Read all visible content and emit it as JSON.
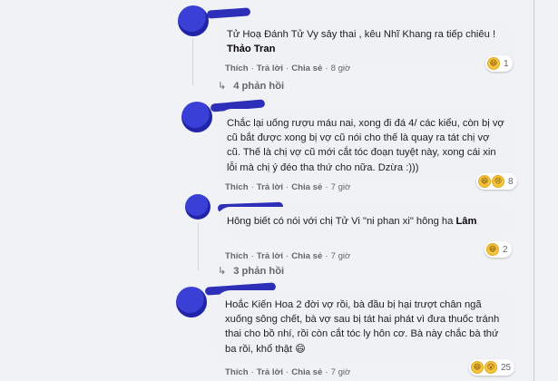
{
  "actions": {
    "like": "Thích",
    "reply": "Trả lời",
    "share": "Chia sẻ"
  },
  "comments": [
    {
      "text": "Tử Hoạ Đánh Tử Vy sảy thai , kêu Nhĩ Khang ra tiếp chiêu !",
      "tag": "Thảo Tran",
      "time": "8 giờ",
      "reaction_count": "1",
      "reactions": [
        "haha-icon"
      ]
    },
    {
      "text": "Chắc lại uống rượu máu nai, xong đi đá 4/ các kiểu, còn bị vợ cũ bắt được xong bị vợ cũ nói cho thế là quay ra tát chị vợ cũ. Thế là chị vợ cũ mới cắt tóc đoạn tuyệt này, xong cái xin lỗi mà chị ý đéo tha thứ cho nữa. Dzừa :)))",
      "time": "7 giờ",
      "reaction_count": "8",
      "reactions": [
        "haha-icon",
        "sad-icon"
      ]
    },
    {
      "text": "Hông biết có nói với chị Tử Vi \"ni phan xi\" hông ha",
      "tag": "Lâm",
      "time": "7 giờ",
      "reaction_count": "2",
      "reactions": [
        "haha-icon"
      ]
    },
    {
      "text": "Hoắc Kiến Hoa 2 đời vợ rồi, bà đầu bị hại trượt chân ngã xuống sông chết, bà vợ sau bị tát hai phát vì đưa thuốc tránh thai cho bồ nhí, rồi còn cắt tóc ly hôn cơ. Bà này chắc bà thứ ba rồi, khổ thật 😄",
      "time": "7 giờ",
      "reaction_count": "25",
      "reactions": [
        "haha-icon",
        "wow-icon"
      ]
    }
  ],
  "reply_links": [
    "4 phản hồi",
    "3 phản hồi"
  ]
}
